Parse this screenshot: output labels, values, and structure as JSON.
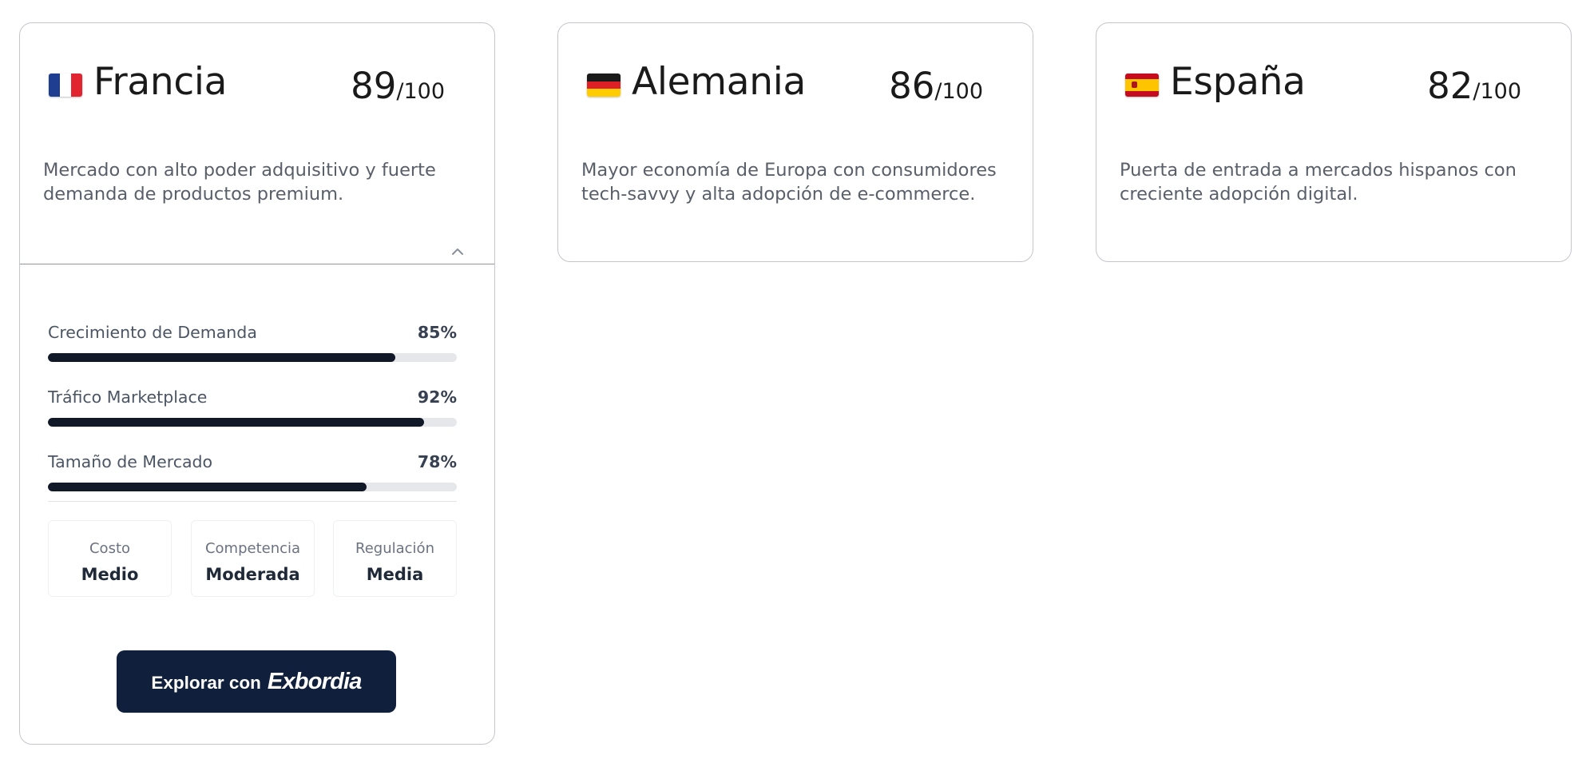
{
  "cards": [
    {
      "country": "Francia",
      "flag_icon": "france-flag-icon",
      "flag_colors": [
        "#1f3d91",
        "#ffffff",
        "#e1242f"
      ],
      "score": "89",
      "score_max": "/100",
      "description": "Mercado con alto poder adquisitivo y fuerte demanda de productos premium.",
      "expanded": true,
      "collapse_icon": "chevron-up-icon",
      "metrics": [
        {
          "label": "Crecimiento de Demanda",
          "value_text": "85%",
          "value": 85
        },
        {
          "label": "Tráfico Marketplace",
          "value_text": "92%",
          "value": 92
        },
        {
          "label": "Tamaño de Mercado",
          "value_text": "78%",
          "value": 78
        }
      ],
      "stats": [
        {
          "label": "Costo",
          "value": "Medio"
        },
        {
          "label": "Competencia",
          "value": "Moderada"
        },
        {
          "label": "Regulación",
          "value": "Media"
        }
      ],
      "cta": {
        "label": "Explorar con",
        "brand": "Exbordia"
      }
    },
    {
      "country": "Alemania",
      "flag_icon": "germany-flag-icon",
      "flag_colors": [
        "#1a1a1a",
        "#dd1f26",
        "#ffcc00"
      ],
      "score": "86",
      "score_max": "/100",
      "description": "Mayor economía de Europa con consumidores tech-savvy y alta adopción de e-commerce.",
      "expanded": false
    },
    {
      "country": "España",
      "flag_icon": "spain-flag-icon",
      "flag_colors": [
        "#c60b1e",
        "#ffc400",
        "#c60b1e"
      ],
      "score": "82",
      "score_max": "/100",
      "description": "Puerta de entrada a mercados hispanos con creciente adopción digital.",
      "expanded": false
    }
  ],
  "colors": {
    "bar_fill": "#111827",
    "bar_track": "#e5e7eb",
    "cta_background": "#101f3c"
  }
}
